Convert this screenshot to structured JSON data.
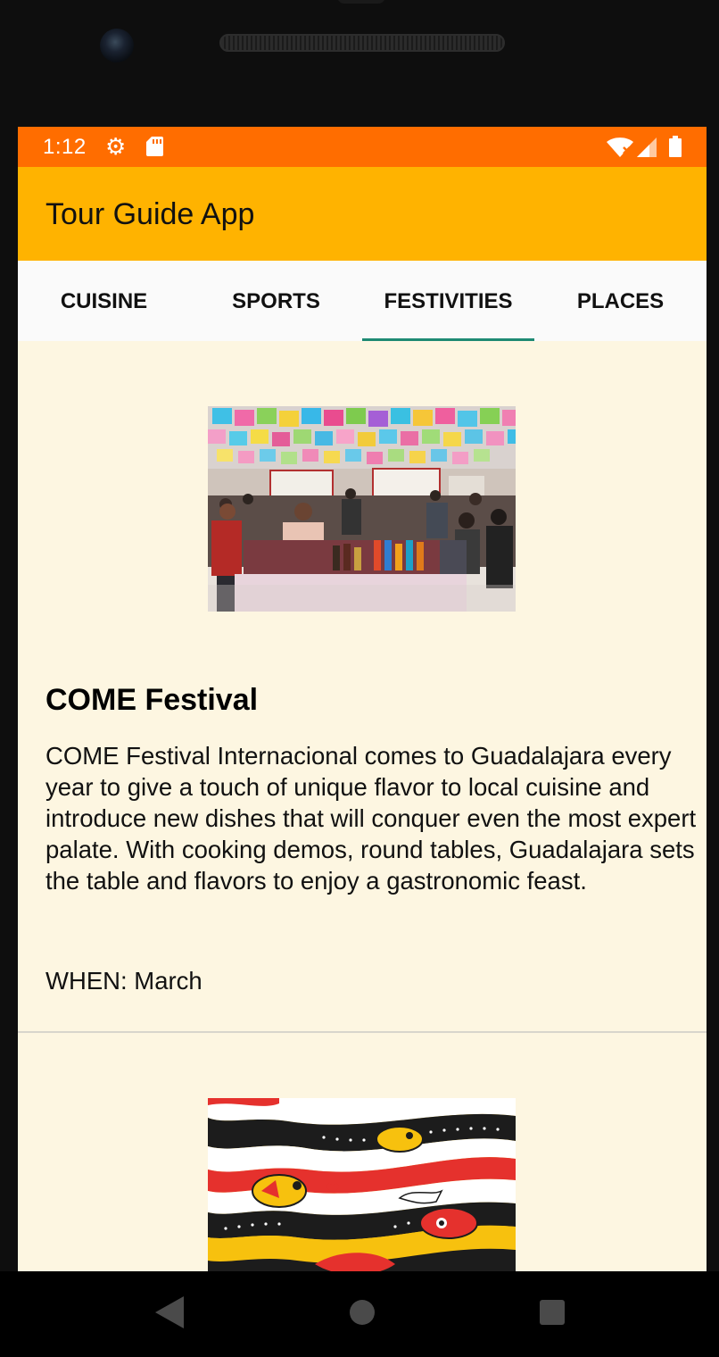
{
  "status_bar": {
    "time": "1:12",
    "icons": [
      "gear-icon",
      "sd-card-icon",
      "wifi-icon",
      "signal-icon",
      "battery-icon"
    ]
  },
  "app_bar": {
    "title": "Tour Guide App",
    "color": "#ffb300"
  },
  "tabs": [
    {
      "label": "CUISINE",
      "active": false
    },
    {
      "label": "SPORTS",
      "active": false
    },
    {
      "label": "FESTIVITIES",
      "active": true
    },
    {
      "label": "PLACES",
      "active": false
    }
  ],
  "colors": {
    "status_bar": "#ff6d00",
    "app_bar": "#ffb300",
    "tab_indicator": "#1e8a73",
    "content_background": "#fdf6e1"
  },
  "cards": [
    {
      "title": "COME Festival",
      "description": "COME Festival Internacional comes to Guadalajara every year to give a touch of unique flavor to local cuisine and introduce new dishes that will conquer even the most expert palate. With cooking demos, round tables, Guadalajara sets the table and flavors to enjoy a gastronomic feast.",
      "when": "WHEN: March",
      "image": "festival-market-photo"
    },
    {
      "image": "colorful-folk-art-illustration"
    }
  ],
  "nav_bar": {
    "icons": [
      "back-icon",
      "home-icon",
      "recents-icon"
    ]
  }
}
